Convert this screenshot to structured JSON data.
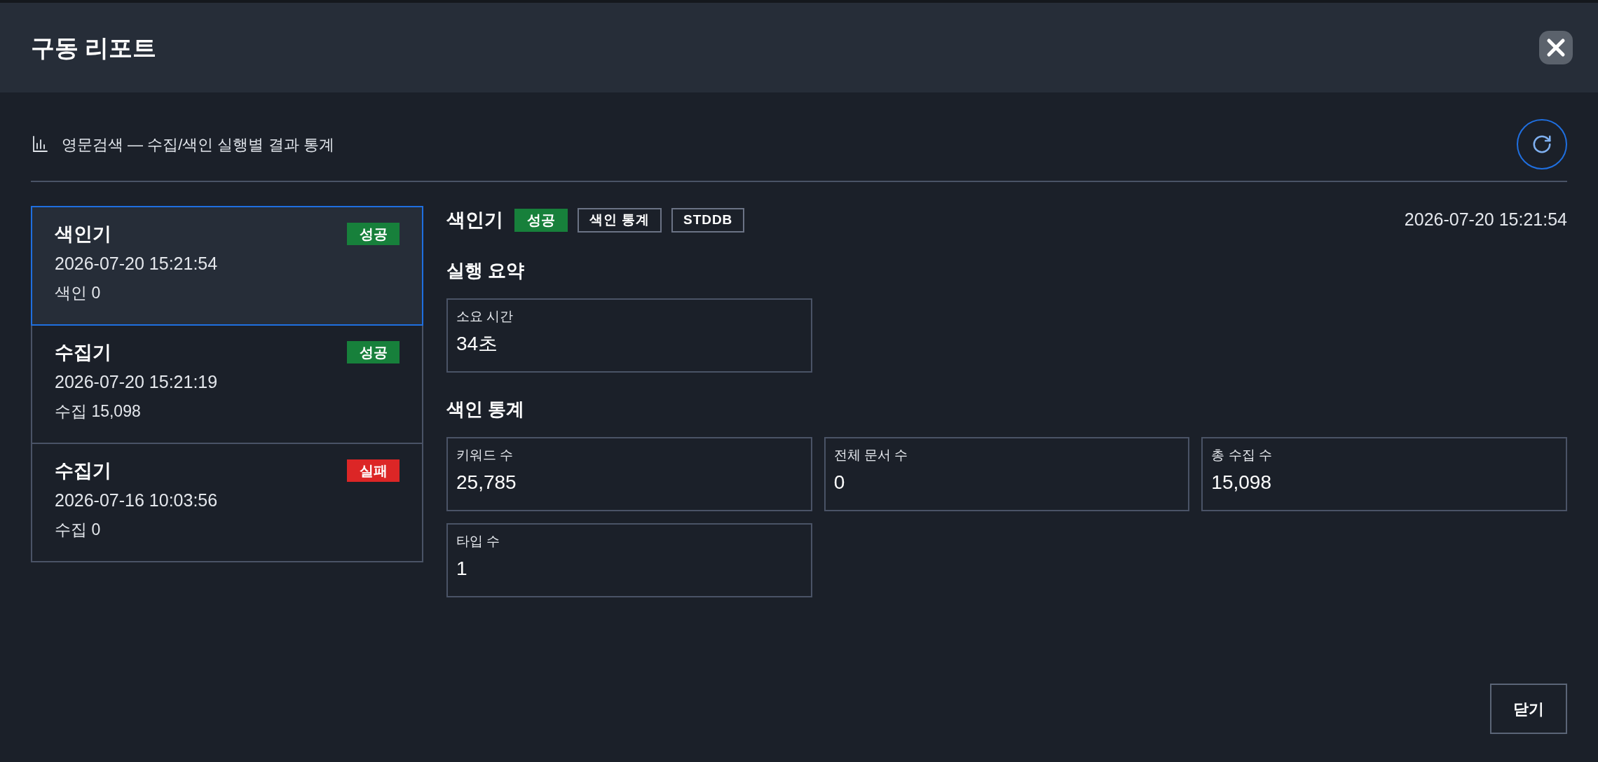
{
  "window": {
    "title": "구동 리포트"
  },
  "subtitle": "영문검색 — 수집/색인 실행별 결과 통계",
  "runs": [
    {
      "name": "색인기",
      "status": {
        "label": "성공",
        "color": "#17803b"
      },
      "time": "2026-07-20 15:21:54",
      "summary": "색인 0",
      "selected": true
    },
    {
      "name": "수집기",
      "status": {
        "label": "성공",
        "color": "#17803b"
      },
      "time": "2026-07-20 15:21:19",
      "summary": "수집 15,098",
      "selected": false
    },
    {
      "name": "수집기",
      "status": {
        "label": "실패",
        "color": "#dc2626"
      },
      "time": "2026-07-16 10:03:56",
      "summary": "수집 0",
      "selected": false
    }
  ],
  "detail": {
    "name": "색인기",
    "tags": [
      {
        "kind": "status",
        "label": "성공",
        "color": "#17803b"
      },
      {
        "kind": "tag",
        "label": "색인 통계"
      },
      {
        "kind": "tag",
        "label": "STDDB"
      }
    ],
    "time": "2026-07-20 15:21:54",
    "sections": [
      {
        "title": "실행 요약",
        "cards": [
          {
            "label": "소요 시간",
            "value": "34초"
          }
        ]
      },
      {
        "title": "색인 통계",
        "cards": [
          {
            "label": "키워드 수",
            "value": "25,785"
          },
          {
            "label": "전체 문서 수",
            "value": "0"
          },
          {
            "label": "총 수집 수",
            "value": "15,098"
          },
          {
            "label": "타입 수",
            "value": "1"
          }
        ]
      }
    ]
  },
  "footer": {
    "close_button": "닫기"
  }
}
